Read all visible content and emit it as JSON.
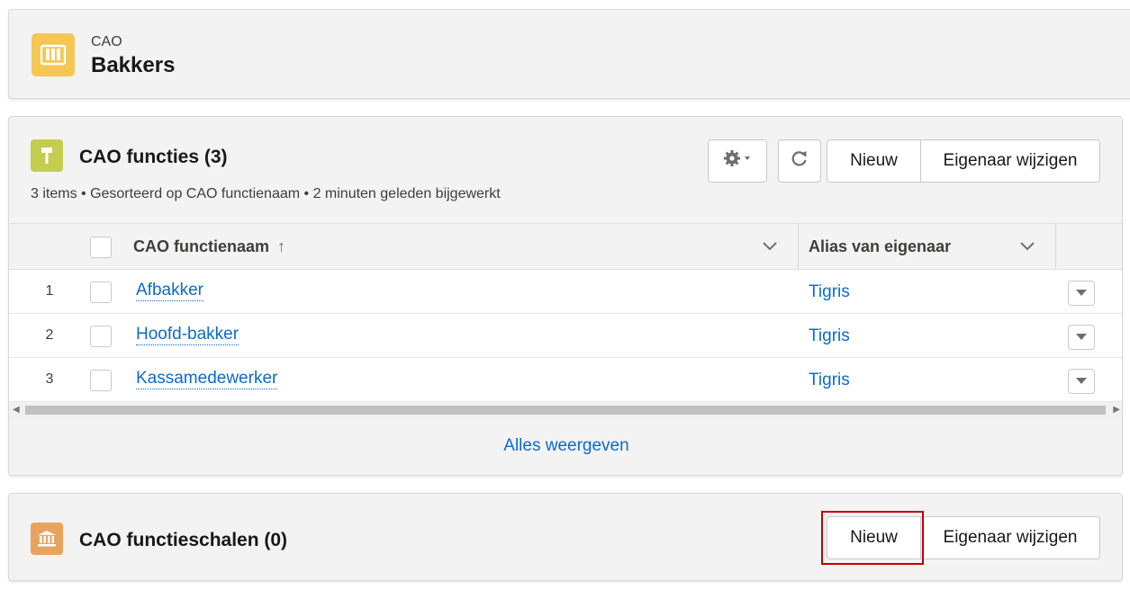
{
  "record": {
    "object_label": "CAO",
    "title": "Bakkers",
    "icon": "book-icon",
    "icon_color": "#f4c653"
  },
  "functies": {
    "title": "CAO functies (3)",
    "icon": "hammer-icon",
    "icon_color": "#c4cd4e",
    "meta": "3 items • Gesorteerd op CAO functienaam • 2 minuten geleden bijgewerkt",
    "buttons": {
      "settings": "gear-icon",
      "refresh": "refresh-icon",
      "new": "Nieuw",
      "change_owner": "Eigenaar wijzigen"
    },
    "columns": [
      {
        "label": "CAO functienaam",
        "sort": "↑"
      },
      {
        "label": "Alias van eigenaar"
      }
    ],
    "rows": [
      {
        "num": "1",
        "name": "Afbakker",
        "owner": "Tigris"
      },
      {
        "num": "2",
        "name": "Hoofd-bakker",
        "owner": "Tigris"
      },
      {
        "num": "3",
        "name": "Kassamedewerker",
        "owner": "Tigris"
      }
    ],
    "view_all": "Alles weergeven"
  },
  "schalen": {
    "title": "CAO functieschalen (0)",
    "icon": "bank-icon",
    "icon_color": "#e8a45c",
    "buttons": {
      "new": "Nieuw",
      "change_owner": "Eigenaar wijzigen"
    }
  },
  "colors": {
    "link": "#0b6bcb",
    "highlight": "#c00000"
  }
}
